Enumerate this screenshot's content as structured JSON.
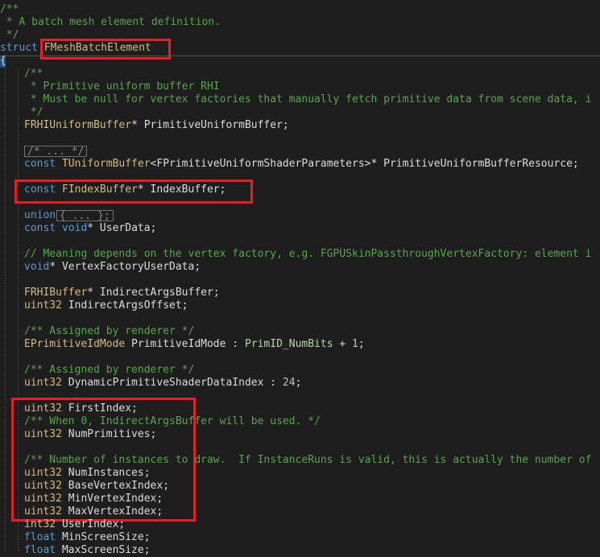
{
  "colors": {
    "background": "#1e1e1e",
    "comment": "#57a64a",
    "keyword": "#569cd6",
    "type": "#d7ba7d",
    "identifier": "#dcdcdc",
    "enum": "#b8d7a3",
    "number": "#b5cea8",
    "highlight_box": "#e51e2a"
  },
  "code_lines": [
    {
      "y": 0,
      "x": 0,
      "tokens": [
        [
          "/**",
          "comment"
        ]
      ]
    },
    {
      "y": 1,
      "x": 0,
      "tokens": [
        [
          " * A batch mesh element definition.",
          "comment"
        ]
      ]
    },
    {
      "y": 2,
      "x": 0,
      "tokens": [
        [
          " */",
          "comment"
        ]
      ]
    },
    {
      "y": 3,
      "x": 0,
      "tokens": [
        [
          "struct",
          "keyword"
        ],
        [
          " ",
          "plain"
        ],
        [
          "FMeshBatchElement",
          "type"
        ]
      ]
    },
    {
      "y": 4,
      "x": 0,
      "tokens": [
        [
          "{",
          "plain"
        ]
      ]
    },
    {
      "y": 5,
      "x": 1,
      "tokens": [
        [
          "/**",
          "comment"
        ]
      ]
    },
    {
      "y": 6,
      "x": 1,
      "tokens": [
        [
          " * Primitive uniform buffer RHI",
          "comment"
        ]
      ]
    },
    {
      "y": 7,
      "x": 1,
      "tokens": [
        [
          " * Must be null for vertex factories that manually fetch primitive data from scene data, i",
          "comment"
        ]
      ]
    },
    {
      "y": 8,
      "x": 1,
      "tokens": [
        [
          " */",
          "comment"
        ]
      ]
    },
    {
      "y": 9,
      "x": 1,
      "tokens": [
        [
          "FRHIUniformBuffer",
          "type"
        ],
        [
          "* PrimitiveUniformBuffer;",
          "plain"
        ]
      ]
    },
    {
      "y": 10,
      "x": 1,
      "tokens": []
    },
    {
      "y": 11,
      "x": 1,
      "tokens": []
    },
    {
      "y": 12,
      "x": 1,
      "tokens": [
        [
          "const",
          "keyword"
        ],
        [
          " ",
          "plain"
        ],
        [
          "TUniformBuffer",
          "type"
        ],
        [
          "<FPrimitiveUniformShaderParameters>* PrimitiveUniformBufferResource;",
          "plain"
        ]
      ]
    },
    {
      "y": 13,
      "x": 1,
      "tokens": []
    },
    {
      "y": 14,
      "x": 1,
      "tokens": [
        [
          "const",
          "keyword"
        ],
        [
          " ",
          "plain"
        ],
        [
          "FIndexBuffer",
          "type"
        ],
        [
          "* IndexBuffer;",
          "plain"
        ]
      ]
    },
    {
      "y": 15,
      "x": 1,
      "tokens": []
    },
    {
      "y": 16,
      "x": 1,
      "tokens": [
        [
          "union",
          "keyword"
        ]
      ]
    },
    {
      "y": 17,
      "x": 1,
      "tokens": [
        [
          "const",
          "keyword"
        ],
        [
          " ",
          "plain"
        ],
        [
          "void",
          "keyword"
        ],
        [
          "* UserData;",
          "plain"
        ]
      ]
    },
    {
      "y": 18,
      "x": 1,
      "tokens": []
    },
    {
      "y": 19,
      "x": 1,
      "tokens": [
        [
          "// Meaning depends on the vertex factory, e.g. FGPUSkinPassthroughVertexFactory: element i",
          "comment"
        ]
      ]
    },
    {
      "y": 20,
      "x": 1,
      "tokens": [
        [
          "void",
          "keyword"
        ],
        [
          "* VertexFactoryUserData;",
          "plain"
        ]
      ]
    },
    {
      "y": 21,
      "x": 1,
      "tokens": []
    },
    {
      "y": 22,
      "x": 1,
      "tokens": [
        [
          "FRHIBuffer",
          "type"
        ],
        [
          "* IndirectArgsBuffer;",
          "plain"
        ]
      ]
    },
    {
      "y": 23,
      "x": 1,
      "tokens": [
        [
          "uint32",
          "type"
        ],
        [
          " IndirectArgsOffset;",
          "plain"
        ]
      ]
    },
    {
      "y": 24,
      "x": 1,
      "tokens": []
    },
    {
      "y": 25,
      "x": 1,
      "tokens": [
        [
          "/** Assigned by renderer */",
          "comment"
        ]
      ]
    },
    {
      "y": 26,
      "x": 1,
      "tokens": [
        [
          "EPrimitiveIdMode",
          "type"
        ],
        [
          " PrimitiveIdMode : ",
          "plain"
        ],
        [
          "PrimID_NumBits",
          "enum"
        ],
        [
          " + ",
          "plain"
        ],
        [
          "1",
          "number"
        ],
        [
          ";",
          "plain"
        ]
      ]
    },
    {
      "y": 27,
      "x": 1,
      "tokens": []
    },
    {
      "y": 28,
      "x": 1,
      "tokens": [
        [
          "/** Assigned by renderer */",
          "comment"
        ]
      ]
    },
    {
      "y": 29,
      "x": 1,
      "tokens": [
        [
          "uint32",
          "type"
        ],
        [
          " DynamicPrimitiveShaderDataIndex : ",
          "plain"
        ],
        [
          "24",
          "number"
        ],
        [
          ";",
          "plain"
        ]
      ]
    },
    {
      "y": 30,
      "x": 1,
      "tokens": []
    },
    {
      "y": 31,
      "x": 1,
      "tokens": [
        [
          "uint32",
          "type"
        ],
        [
          " FirstIndex;",
          "plain"
        ]
      ]
    },
    {
      "y": 32,
      "x": 1,
      "tokens": [
        [
          "/** When 0, IndirectArgsBuffer will be used. */",
          "comment"
        ]
      ]
    },
    {
      "y": 33,
      "x": 1,
      "tokens": [
        [
          "uint32",
          "type"
        ],
        [
          " NumPrimitives;",
          "plain"
        ]
      ]
    },
    {
      "y": 34,
      "x": 1,
      "tokens": []
    },
    {
      "y": 35,
      "x": 1,
      "tokens": [
        [
          "/** Number of instances to draw.  If InstanceRuns is valid, this is actually the number of",
          "comment"
        ]
      ]
    },
    {
      "y": 36,
      "x": 1,
      "tokens": [
        [
          "uint32",
          "type"
        ],
        [
          " NumInstances;",
          "plain"
        ]
      ]
    },
    {
      "y": 37,
      "x": 1,
      "tokens": [
        [
          "uint32",
          "type"
        ],
        [
          " BaseVertexIndex;",
          "plain"
        ]
      ]
    },
    {
      "y": 38,
      "x": 1,
      "tokens": [
        [
          "uint32",
          "type"
        ],
        [
          " MinVertexIndex;",
          "plain"
        ]
      ]
    },
    {
      "y": 39,
      "x": 1,
      "tokens": [
        [
          "uint32",
          "type"
        ],
        [
          " MaxVertexIndex;",
          "plain"
        ]
      ]
    },
    {
      "y": 40,
      "x": 1,
      "tokens": [
        [
          "int32",
          "type"
        ],
        [
          " UserIndex;",
          "plain"
        ]
      ]
    },
    {
      "y": 41,
      "x": 1,
      "tokens": [
        [
          "float",
          "keyword"
        ],
        [
          " MinScreenSize;",
          "plain"
        ]
      ]
    },
    {
      "y": 42,
      "x": 1,
      "tokens": [
        [
          "float",
          "keyword"
        ],
        [
          " MaxScreenSize;",
          "plain"
        ]
      ]
    }
  ],
  "folds": [
    {
      "label": "/* ... */"
    },
    {
      "label": "{ ... };"
    }
  ]
}
